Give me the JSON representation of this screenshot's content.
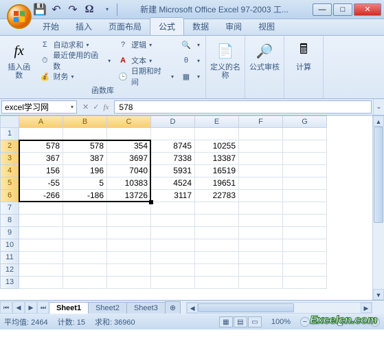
{
  "title": "新建 Microsoft Office Excel 97-2003 工...",
  "tabs": [
    "开始",
    "插入",
    "页面布局",
    "公式",
    "数据",
    "审阅",
    "视图"
  ],
  "activeTab": 3,
  "ribbon": {
    "insertFn": "插入函数",
    "autosum": "自动求和",
    "recent": "最近使用的函数",
    "financial": "财务",
    "logic": "逻辑",
    "text": "文本",
    "datetime": "日期和时间",
    "groupLib": "函数库",
    "definedNames": "定义的名称",
    "formulaAudit": "公式审核",
    "calc": "计算"
  },
  "nameBox": "excel学习网",
  "formulaValue": "578",
  "cols": [
    "A",
    "B",
    "C",
    "D",
    "E",
    "F",
    "G"
  ],
  "rowCount": 13,
  "selectedCols": [
    0,
    1,
    2
  ],
  "selectedRows": [
    2,
    3,
    4,
    5,
    6
  ],
  "chart_data": {
    "type": "table",
    "columns": [
      "A",
      "B",
      "C",
      "D",
      "E"
    ],
    "rows": [
      [
        578,
        578,
        354,
        8745,
        10255
      ],
      [
        367,
        387,
        3697,
        7338,
        13387
      ],
      [
        156,
        196,
        7040,
        5931,
        16519
      ],
      [
        -55,
        5,
        10383,
        4524,
        19651
      ],
      [
        -266,
        -186,
        13726,
        3117,
        22783
      ]
    ]
  },
  "sheets": [
    "Sheet1",
    "Sheet2",
    "Sheet3"
  ],
  "activeSheet": 0,
  "status": {
    "avg": "平均值: 2464",
    "count": "计数: 15",
    "sum": "求和: 36960",
    "zoom": "100%"
  },
  "watermark": "Excelcn.com",
  "icons": {
    "min": "—",
    "max": "□",
    "close": "✕"
  }
}
